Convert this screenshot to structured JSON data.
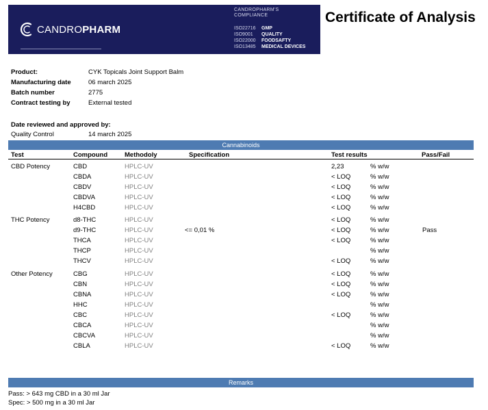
{
  "header": {
    "brand_light": "CANDRO",
    "brand_bold": "PHARM",
    "compliance_line1": "CANDROPHARM'S",
    "compliance_line2": "COMPLIANCE",
    "iso": [
      {
        "code": "ISO22716",
        "label": "GMP"
      },
      {
        "code": "ISO9001",
        "label": "QUALITY"
      },
      {
        "code": "ISO22000",
        "label": "FOODSAFTY"
      },
      {
        "code": "ISO13485",
        "label": "MEDICAL DEVICES"
      }
    ],
    "title": "Certificate of Analysis"
  },
  "product_info": [
    {
      "label": "Product:",
      "value": "CYK Topicals Joint Support Balm"
    },
    {
      "label": "Manufacturing date",
      "value": "06 march 2025"
    },
    {
      "label": "Batch number",
      "value": "2775"
    },
    {
      "label": "Contract testing by",
      "value": "External tested"
    }
  ],
  "review": {
    "heading": "Date reviewed and approved by:",
    "label": "Quality Control",
    "value": "14 march 2025"
  },
  "cannabinoids": {
    "section_title": "Cannabinoids",
    "columns": [
      "Test",
      "Compound",
      "Methodoly",
      "Specification",
      "Test results",
      "Pass/Fail"
    ],
    "groups": [
      {
        "test": "CBD Potency",
        "rows": [
          {
            "compound": "CBD",
            "method": "HPLC-UV",
            "spec": "",
            "result": "2,23",
            "unit": "% w/w",
            "pass": ""
          },
          {
            "compound": "CBDA",
            "method": "HPLC-UV",
            "spec": "",
            "result": "< LOQ",
            "unit": "% w/w",
            "pass": ""
          },
          {
            "compound": "CBDV",
            "method": "HPLC-UV",
            "spec": "",
            "result": "< LOQ",
            "unit": "% w/w",
            "pass": ""
          },
          {
            "compound": "CBDVA",
            "method": "HPLC-UV",
            "spec": "",
            "result": "< LOQ",
            "unit": "% w/w",
            "pass": ""
          },
          {
            "compound": "H4CBD",
            "method": "HPLC-UV",
            "spec": "",
            "result": "< LOQ",
            "unit": "% w/w",
            "pass": ""
          }
        ]
      },
      {
        "test": "THC Potency",
        "rows": [
          {
            "compound": "d8-THC",
            "method": "HPLC-UV",
            "spec": "",
            "result": "< LOQ",
            "unit": "% w/w",
            "pass": ""
          },
          {
            "compound": "d9-THC",
            "method": "HPLC-UV",
            "spec": "<= 0,01 %",
            "result": "< LOQ",
            "unit": "% w/w",
            "pass": "Pass"
          },
          {
            "compound": "THCA",
            "method": "HPLC-UV",
            "spec": "",
            "result": "< LOQ",
            "unit": "% w/w",
            "pass": ""
          },
          {
            "compound": "THCP",
            "method": "HPLC-UV",
            "spec": "",
            "result": "",
            "unit": "% w/w",
            "pass": ""
          },
          {
            "compound": "THCV",
            "method": "HPLC-UV",
            "spec": "",
            "result": "< LOQ",
            "unit": "% w/w",
            "pass": ""
          }
        ]
      },
      {
        "test": "Other Potency",
        "rows": [
          {
            "compound": "CBG",
            "method": "HPLC-UV",
            "spec": "",
            "result": "< LOQ",
            "unit": "% w/w",
            "pass": ""
          },
          {
            "compound": "CBN",
            "method": "HPLC-UV",
            "spec": "",
            "result": "< LOQ",
            "unit": "% w/w",
            "pass": ""
          },
          {
            "compound": "CBNA",
            "method": "HPLC-UV",
            "spec": "",
            "result": "< LOQ",
            "unit": "% w/w",
            "pass": ""
          },
          {
            "compound": "HHC",
            "method": "HPLC-UV",
            "spec": "",
            "result": "",
            "unit": "% w/w",
            "pass": ""
          },
          {
            "compound": "CBC",
            "method": "HPLC-UV",
            "spec": "",
            "result": "< LOQ",
            "unit": "% w/w",
            "pass": ""
          },
          {
            "compound": "CBCA",
            "method": "HPLC-UV",
            "spec": "",
            "result": "",
            "unit": "% w/w",
            "pass": ""
          },
          {
            "compound": "CBCVA",
            "method": "HPLC-UV",
            "spec": "",
            "result": "",
            "unit": "% w/w",
            "pass": ""
          },
          {
            "compound": "CBLA",
            "method": "HPLC-UV",
            "spec": "",
            "result": "< LOQ",
            "unit": "% w/w",
            "pass": ""
          }
        ]
      }
    ]
  },
  "remarks": {
    "section_title": "Remarks",
    "lines": [
      "Pass: > 643 mg CBD in a 30 ml Jar",
      "Spec: > 500 mg in a 30 ml Jar"
    ]
  },
  "colors": {
    "banner": "#1a1d5c",
    "section_bar": "#4e7bb2",
    "muted_text": "#7f7f7f"
  }
}
